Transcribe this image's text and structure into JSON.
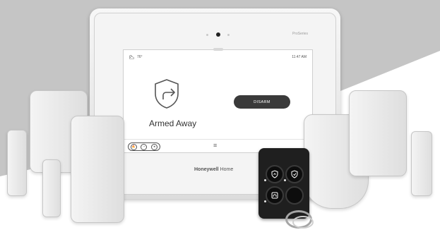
{
  "device": {
    "brand_name": "Honeywell",
    "brand_suffix": "Home",
    "model_label": "ProSeries"
  },
  "screen": {
    "temperature": "76°",
    "weather_icon": "partly-cloudy-icon",
    "time": "11:47 AM",
    "status_icon": "armed-away-shield-icon",
    "status_text": "Armed Away",
    "disarm_label": "DISARM",
    "bottom_bar": {
      "quick_icons": [
        "fire-icon",
        "plus-icon",
        "police-icon"
      ],
      "menu_icon": "menu-icon"
    }
  },
  "key_fob": {
    "buttons": [
      "arm-away-icon",
      "arm-stay-icon",
      "disarm-home-icon",
      "aux-button-icon"
    ]
  },
  "colors": {
    "backdrop_gray": "#c5c5c5",
    "disarm_button": "#3a3a3a",
    "fob_body": "#1f1f1f"
  }
}
